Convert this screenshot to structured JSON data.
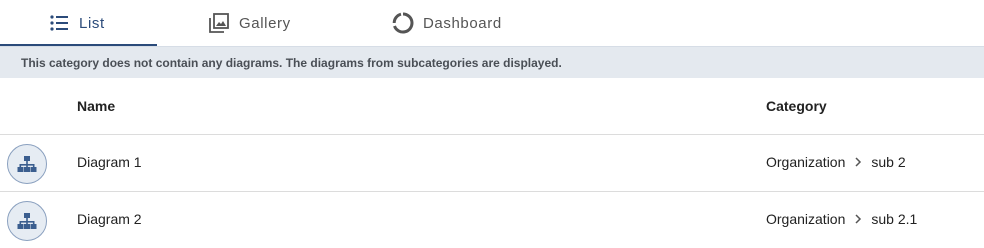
{
  "tabs": [
    {
      "label": "List",
      "icon": "list-icon",
      "active": true
    },
    {
      "label": "Gallery",
      "icon": "gallery-icon",
      "active": false
    },
    {
      "label": "Dashboard",
      "icon": "dashboard-icon",
      "active": false
    }
  ],
  "notice": "This category does not contain any diagrams. The diagrams from subcategories are displayed.",
  "table": {
    "columns": {
      "name": "Name",
      "category": "Category"
    },
    "rows": [
      {
        "icon": "org-chart-icon",
        "name": "Diagram 1",
        "category_path": [
          "Organization",
          "sub 2"
        ]
      },
      {
        "icon": "org-chart-icon",
        "name": "Diagram 2",
        "category_path": [
          "Organization",
          "sub 2.1"
        ]
      }
    ]
  },
  "colors": {
    "accent": "#2b4b7a",
    "notice_bg": "#e4e9ef",
    "icon_blue": "#3b5e8f"
  }
}
